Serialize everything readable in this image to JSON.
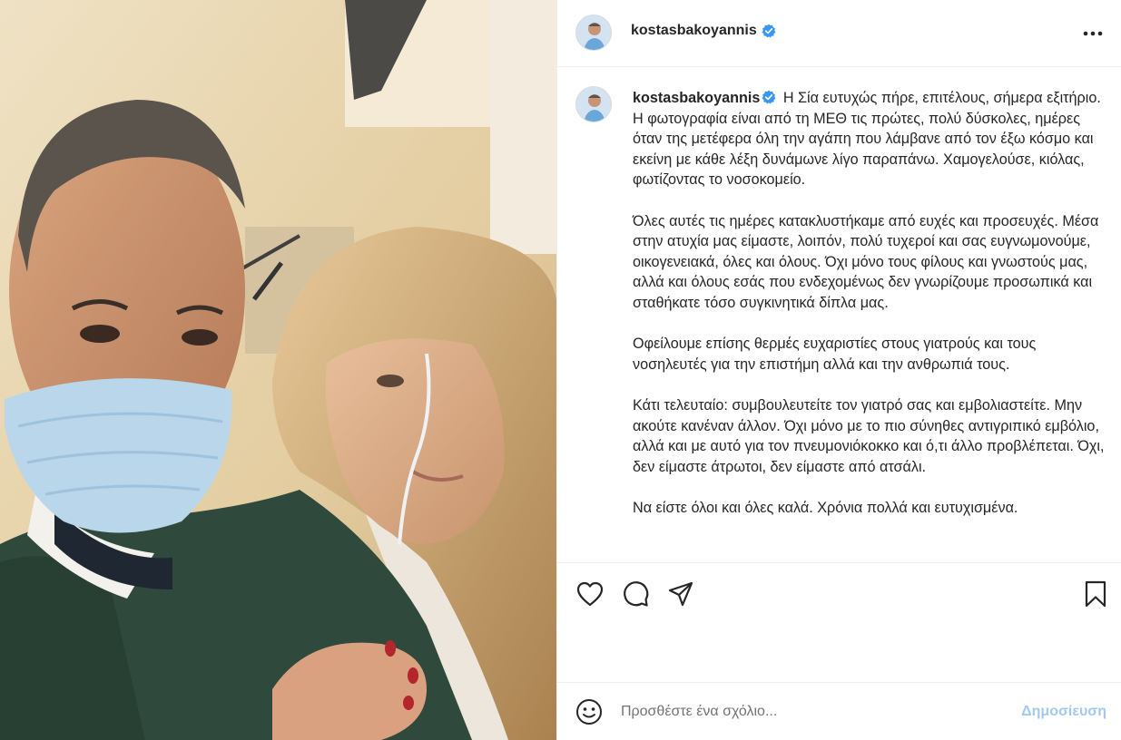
{
  "post": {
    "author": "kostasbakoyannis",
    "verified": true,
    "more_icon": "more-horizontal-icon",
    "photo_alt": "selfie-photo"
  },
  "caption": {
    "author": "kostasbakoyannis",
    "text": " Η Σία ευτυχώς πήρε, επιτέλους, σήμερα εξιτήριο. Η φωτογραφία είναι από τη ΜΕΘ τις πρώτες, πολύ δύσκολες, ημέρες όταν της μετέφερα όλη την αγάπη που λάμβανε από τον έξω κόσμο και εκείνη με κάθε λέξη δυνάμωνε λίγο παραπάνω. Χαμογελούσε, κιόλας, φωτίζοντας το νοσοκομείο.\n\nΌλες αυτές τις ημέρες κατακλυστήκαμε από ευχές και προσευχές. Μέσα στην ατυχία μας είμαστε, λοιπόν, πολύ τυχεροί και σας ευγνωμονούμε, οικογενειακά, όλες και όλους. Όχι μόνο τους φίλους και γνωστούς μας, αλλά και όλους εσάς που ενδεχομένως δεν γνωρίζουμε προσωπικά και σταθήκατε τόσο συγκινητικά δίπλα μας.\n\nΟφείλουμε επίσης θερμές ευχαριστίες στους γιατρούς και τους νοσηλευτές για την επιστήμη αλλά και την ανθρωπιά τους.\n\nΚάτι τελευταίο: συμβουλευτείτε τον γιατρό σας και εμβολιαστείτε. Μην ακούτε κανέναν άλλον. Όχι μόνο με το πιο σύνηθες αντιγριπικό εμβόλιο, αλλά και με αυτό για τον πνευμονιόκοκκο και ό,τι άλλο προβλέπεται. Όχι, δεν είμαστε άτρωτοι, δεν είμαστε από ατσάλι.\n\nΝα είστε όλοι και όλες καλά. Χρόνια πολλά και ευτυχισμένα."
  },
  "actions": {
    "like_icon": "heart-icon",
    "comment_icon": "comment-icon",
    "share_icon": "share-icon",
    "save_icon": "bookmark-icon"
  },
  "comment_box": {
    "emoji_icon": "emoji-icon",
    "placeholder": "Προσθέστε ένα σχόλιο...",
    "post_label": "Δημοσίευση"
  },
  "colors": {
    "verified_blue": "#3897f0",
    "post_button_disabled": "#a3c9f0",
    "border": "#efefef",
    "text": "#262626"
  }
}
